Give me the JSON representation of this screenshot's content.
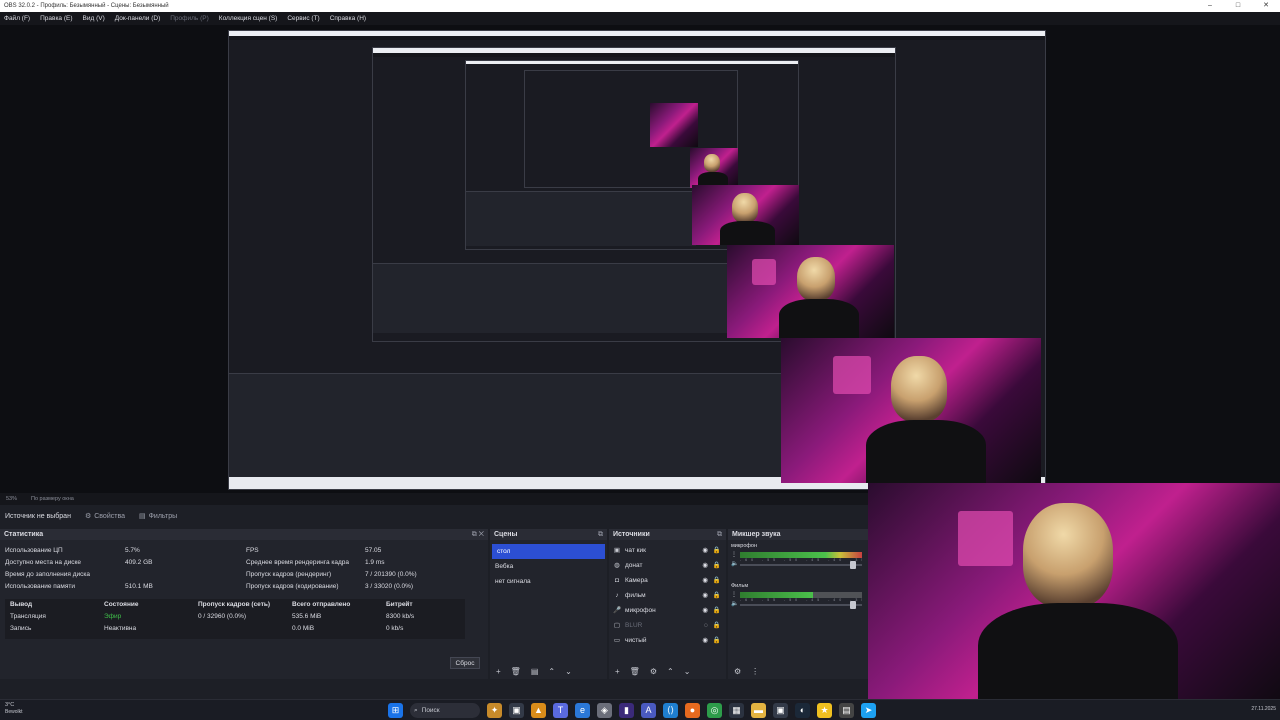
{
  "window": {
    "title": "OBS 32.0.2 - Профиль: Безымянный - Сцены: Безымянный",
    "controls": [
      "–",
      "□",
      "✕"
    ]
  },
  "menu": [
    {
      "label": "Файл (F)",
      "enabled": true
    },
    {
      "label": "Правка (E)",
      "enabled": true
    },
    {
      "label": "Вид (V)",
      "enabled": true
    },
    {
      "label": "Док-панели (D)",
      "enabled": true
    },
    {
      "label": "Профиль (P)",
      "enabled": false
    },
    {
      "label": "Коллекция сцен (S)",
      "enabled": true
    },
    {
      "label": "Сервис (T)",
      "enabled": true
    },
    {
      "label": "Справка (H)",
      "enabled": true
    }
  ],
  "status_strip": {
    "zoom": "53%",
    "fit": "По размеру окна"
  },
  "source_bar": {
    "no_source": "Источник не выбран",
    "properties": "Свойства",
    "filters": "Фильтры"
  },
  "stats": {
    "title": "Статистика",
    "rows_left": [
      {
        "label": "Использование ЦП",
        "value": "5.7%"
      },
      {
        "label": "Доступно места на диске",
        "value": "409.2 GB"
      },
      {
        "label": "Время до заполнения диска",
        "value": ""
      },
      {
        "label": "Использование памяти",
        "value": "510.1 MB"
      }
    ],
    "rows_right": [
      {
        "label": "FPS",
        "value": "57.05"
      },
      {
        "label": "Среднее время рендеринга кадра",
        "value": "1.9 ms"
      },
      {
        "label": "Пропуск кадров (рендеринг)",
        "value": "7 / 201390 (0.0%)"
      },
      {
        "label": "Пропуск кадров (кодирование)",
        "value": "3 / 33020 (0.0%)"
      }
    ],
    "output_headers": [
      "Вывод",
      "Состояние",
      "Пропуск кадров (сеть)",
      "Всего отправлено",
      "Битрейт"
    ],
    "outputs": [
      {
        "name": "Трансляция",
        "state": "Эфир",
        "dropped": "0 / 32960 (0.0%)",
        "sent": "535.6 MiB",
        "bitrate": "8300 kb/s"
      },
      {
        "name": "Запись",
        "state": "Неактивна",
        "dropped": "",
        "sent": "0.0 MiB",
        "bitrate": "0 kb/s"
      }
    ],
    "reset": "Сброс"
  },
  "scenes": {
    "title": "Сцены",
    "items": [
      "стол",
      "Вебка",
      "нет сигнала"
    ],
    "selected": 0
  },
  "sources": {
    "title": "Источники",
    "items": [
      {
        "label": "чат кик",
        "icon": "chat-icon",
        "visible": true
      },
      {
        "label": "донат",
        "icon": "globe-icon",
        "visible": true
      },
      {
        "label": "Камера",
        "icon": "camera-icon",
        "visible": true
      },
      {
        "label": "фильм",
        "icon": "speaker-icon",
        "visible": true
      },
      {
        "label": "микрофон",
        "icon": "mic-icon",
        "visible": true
      },
      {
        "label": "BLUR",
        "icon": "image-icon",
        "visible": false
      },
      {
        "label": "чистый",
        "icon": "window-icon",
        "visible": true
      }
    ]
  },
  "mixer": {
    "title": "Микшер звука",
    "channels": [
      {
        "name": "микрофон",
        "level": 0.9,
        "volume": 0.95
      },
      {
        "name": "Фильм",
        "level": 0.6,
        "volume": 0.95
      }
    ],
    "scale": "-60 -55 -50 -45 -40 -35 -30 -25 -20 -15 -10 -5 0"
  },
  "taskbar": {
    "temperature": "3°C",
    "weather": "Bewolkt",
    "search": "Поиск",
    "date": "27.11.2025"
  },
  "colors": {
    "accent": "#2c4fd3",
    "live": "#3fbf4a"
  }
}
